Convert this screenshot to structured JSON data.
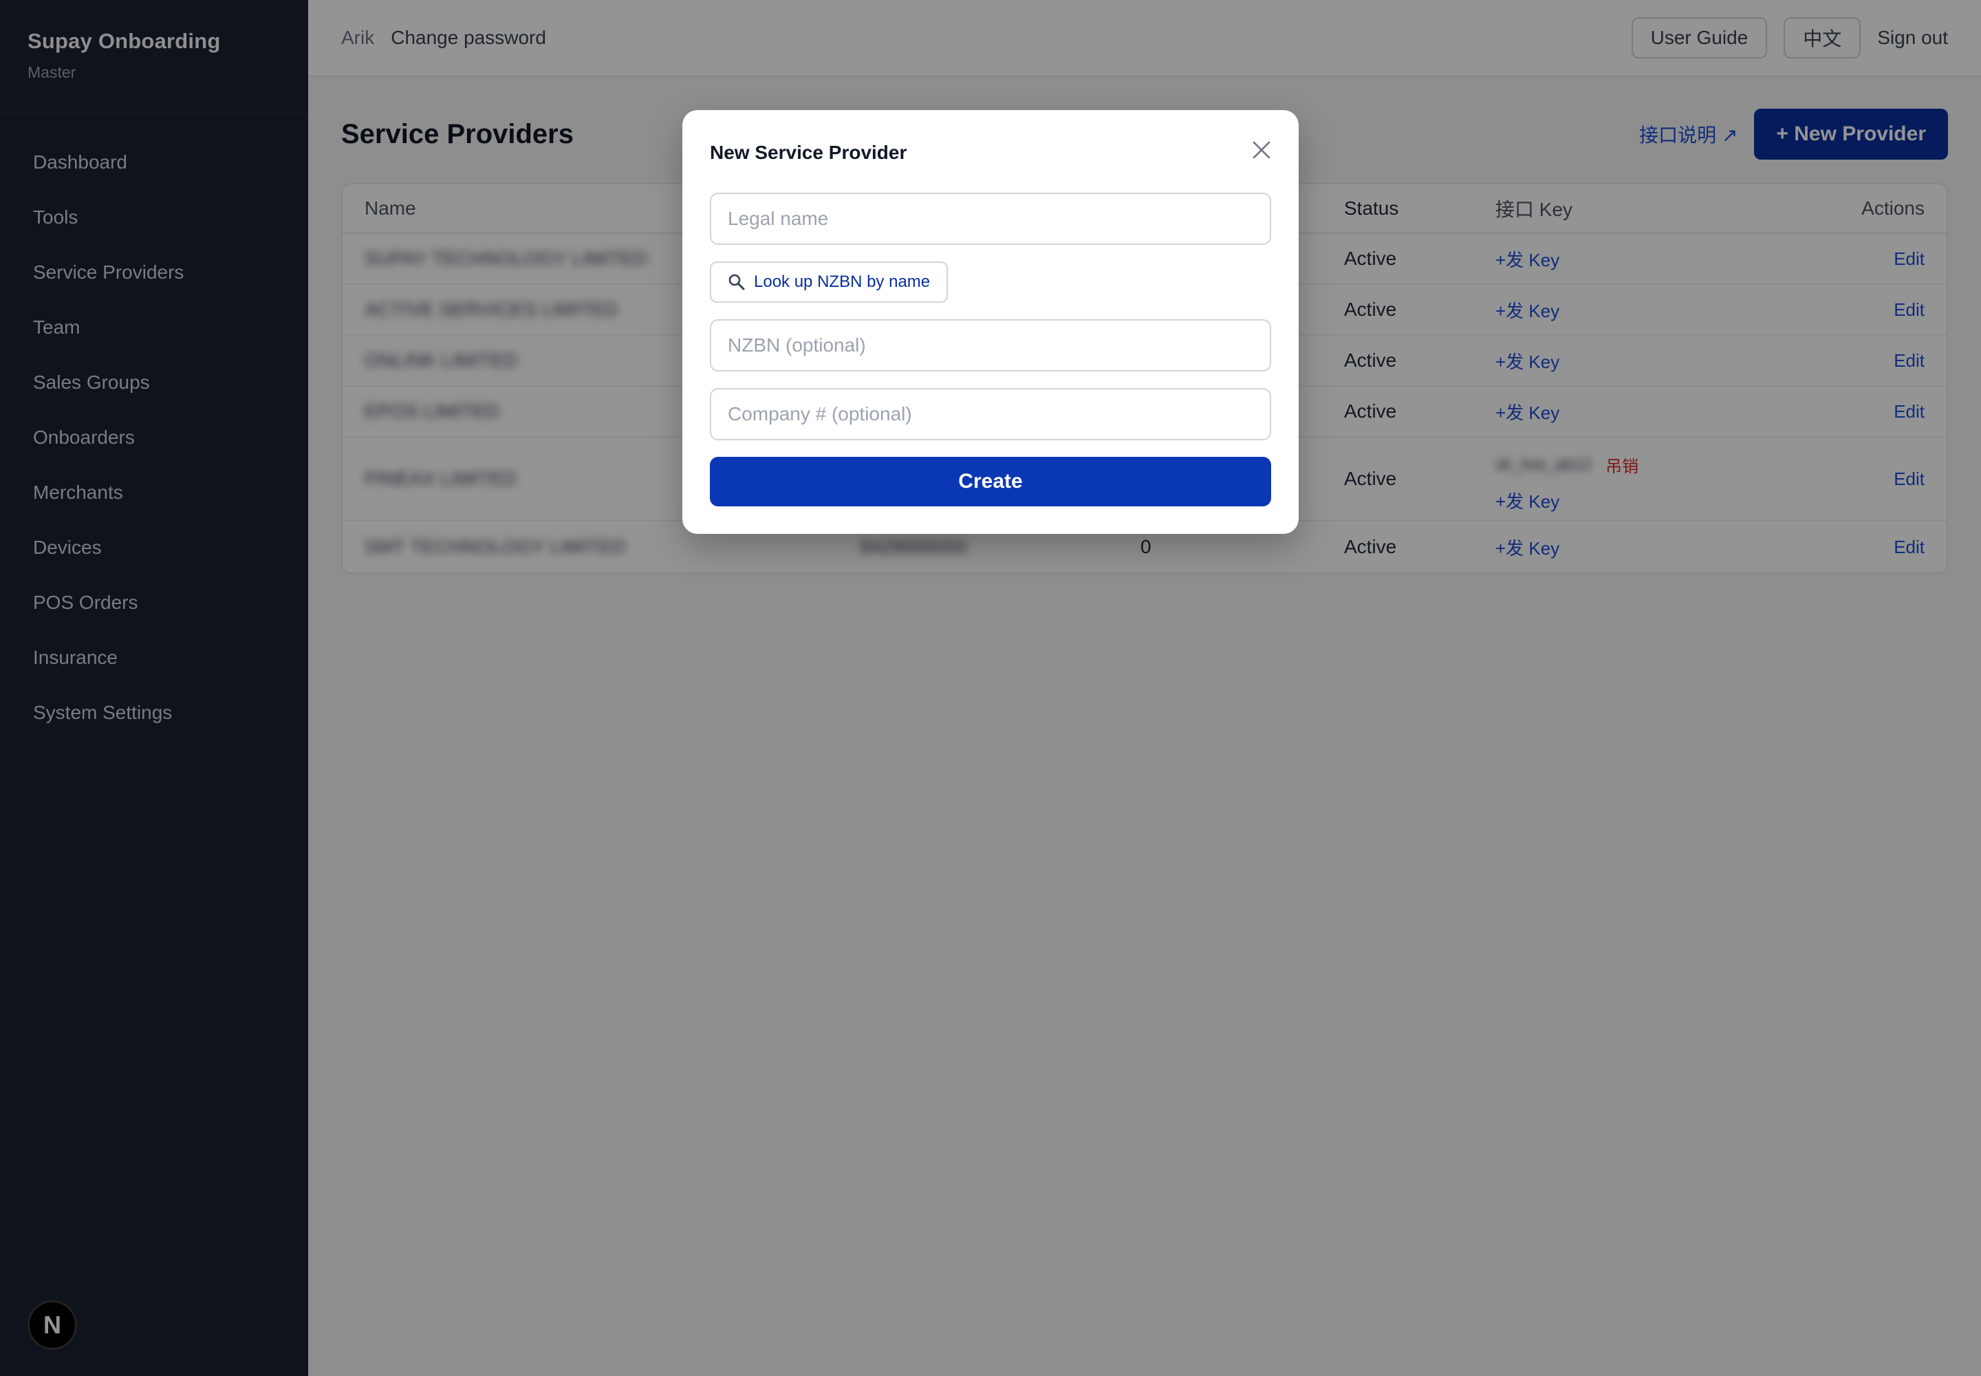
{
  "sidebar": {
    "brand_title": "Supay Onboarding",
    "brand_sub": "Master",
    "items": [
      {
        "label": "Dashboard"
      },
      {
        "label": "Tools"
      },
      {
        "label": "Service Providers"
      },
      {
        "label": "Team"
      },
      {
        "label": "Sales Groups"
      },
      {
        "label": "Onboarders"
      },
      {
        "label": "Merchants"
      },
      {
        "label": "Devices"
      },
      {
        "label": "POS Orders"
      },
      {
        "label": "Insurance"
      },
      {
        "label": "System Settings"
      }
    ],
    "badge": "N"
  },
  "topbar": {
    "user": "Arik",
    "change_password": "Change password",
    "user_guide": "User Guide",
    "language": "中文",
    "sign_out": "Sign out"
  },
  "page": {
    "title": "Service Providers",
    "api_link": "接口说明 ↗",
    "new_provider": "+ New Provider"
  },
  "table": {
    "headers": {
      "name": "Name",
      "status": "Status",
      "key": "接口 Key",
      "actions": "Actions"
    },
    "rows": [
      {
        "name": "SUPAY TECHNOLOGY LIMITED",
        "status": "Active",
        "key": "+发 Key",
        "action": "Edit"
      },
      {
        "name": "ACTIVE SERVICES LIMITED",
        "status": "Active",
        "key": "+发 Key",
        "action": "Edit"
      },
      {
        "name": "ONLINK LIMITED",
        "status": "Active",
        "key": "+发 Key",
        "action": "Edit"
      },
      {
        "name": "EPOS LIMITED",
        "status": "Active",
        "key": "+发 Key",
        "action": "Edit"
      },
      {
        "name": "PINEAX LIMITED",
        "status": "Active",
        "key_existing": "sk_live_ab12",
        "revoke": "吊销",
        "key": "+发 Key",
        "action": "Edit"
      },
      {
        "name": "SMT TECHNOLOGY LIMITED",
        "nzbn": "9429000000",
        "count": "0",
        "status": "Active",
        "key": "+发 Key",
        "action": "Edit"
      }
    ]
  },
  "modal": {
    "title": "New Service Provider",
    "legal_name_placeholder": "Legal name",
    "lookup_label": "Look up NZBN by name",
    "nzbn_placeholder": "NZBN (optional)",
    "company_placeholder": "Company # (optional)",
    "create_label": "Create"
  }
}
